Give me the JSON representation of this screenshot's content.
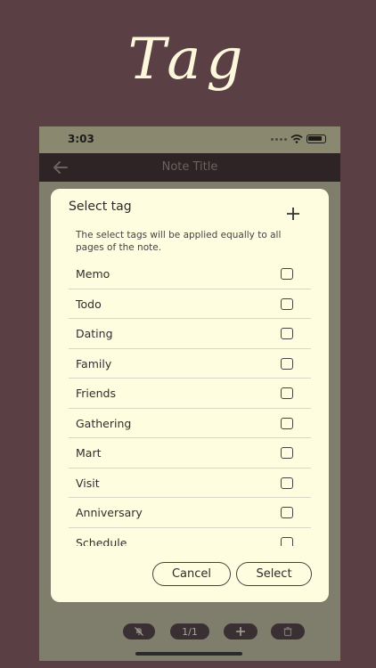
{
  "hero": {
    "title": "Tag"
  },
  "status_bar": {
    "time": "3:03"
  },
  "nav": {
    "title": "Note Title"
  },
  "dialog": {
    "title": "Select tag",
    "description": "The select tags will be applied equally to all pages of the note.",
    "tags": [
      {
        "label": "Memo",
        "checked": false
      },
      {
        "label": "Todo",
        "checked": false
      },
      {
        "label": "Dating",
        "checked": false
      },
      {
        "label": "Family",
        "checked": false
      },
      {
        "label": "Friends",
        "checked": false
      },
      {
        "label": "Gathering",
        "checked": false
      },
      {
        "label": "Mart",
        "checked": false
      },
      {
        "label": "Visit",
        "checked": false
      },
      {
        "label": "Anniversary",
        "checked": false
      },
      {
        "label": "Schedule",
        "checked": false
      }
    ],
    "cancel_label": "Cancel",
    "select_label": "Select"
  },
  "bottom_bar": {
    "page_indicator": "1/1"
  },
  "colors": {
    "background": "#5a4044",
    "dialog": "#fffde0",
    "nav_bar": "#2f2425",
    "phone_overlay": "#7f7d6c"
  }
}
